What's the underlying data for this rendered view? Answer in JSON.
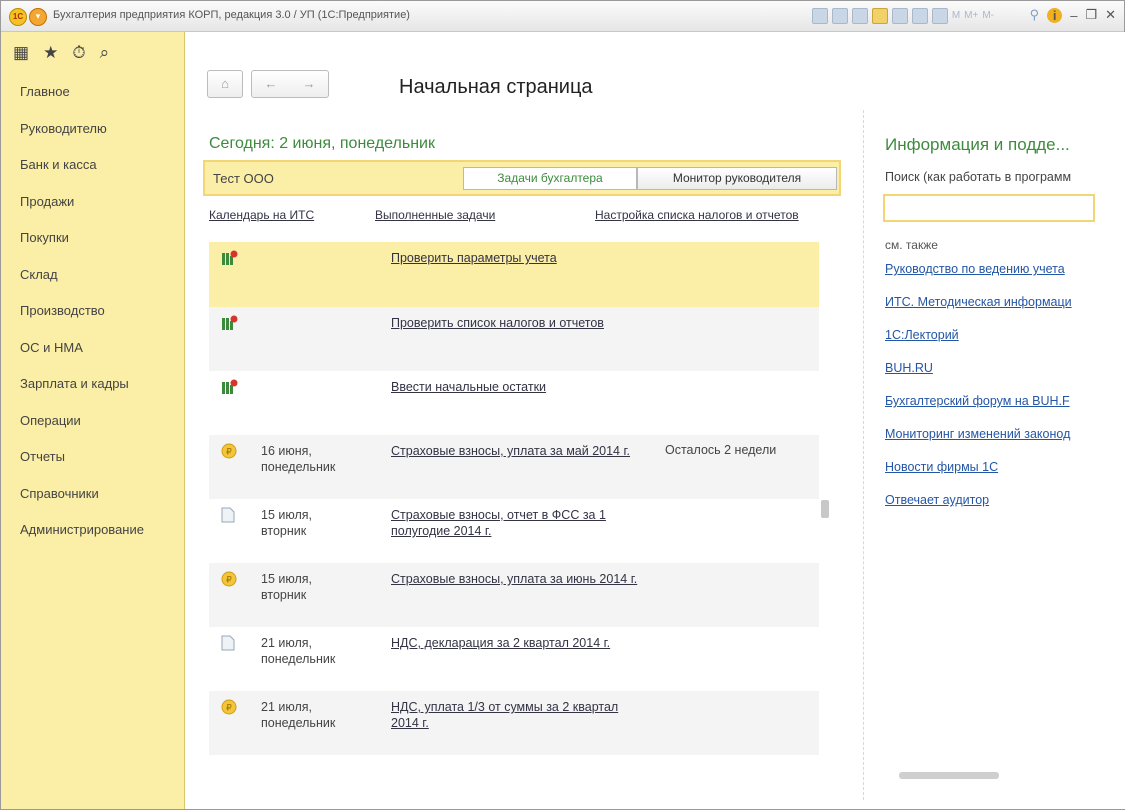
{
  "window": {
    "title": "Бухгалтерия предприятия КОРП, редакция 3.0 / УП  (1С:Предприятие)",
    "mem_buttons": [
      "M",
      "M+",
      "M-"
    ]
  },
  "sidebar": {
    "items": [
      {
        "label": "Главное"
      },
      {
        "label": "Руководителю"
      },
      {
        "label": "Банк и касса"
      },
      {
        "label": "Продажи"
      },
      {
        "label": "Покупки"
      },
      {
        "label": "Склад"
      },
      {
        "label": "Производство"
      },
      {
        "label": "ОС и НМА"
      },
      {
        "label": "Зарплата и кадры"
      },
      {
        "label": "Операции"
      },
      {
        "label": "Отчеты"
      },
      {
        "label": "Справочники"
      },
      {
        "label": "Администрирование"
      }
    ]
  },
  "main": {
    "page_title": "Начальная страница",
    "today": "Сегодня: 2 июня, понедельник",
    "org": "Тест ООО",
    "tabs": {
      "accountant": "Задачи бухгалтера",
      "monitor": "Монитор руководителя"
    },
    "links": {
      "calendar": "Календарь на ИТС",
      "done": "Выполненные задачи",
      "settings": "Настройка списка налогов и отчетов"
    },
    "tasks": [
      {
        "icon": "checklist",
        "date": "",
        "title": "Проверить параметры учета",
        "remaining": ""
      },
      {
        "icon": "checklist",
        "date": "",
        "title": "Проверить список налогов и отчетов",
        "remaining": ""
      },
      {
        "icon": "checklist",
        "date": "",
        "title": "Ввести начальные остатки",
        "remaining": ""
      },
      {
        "icon": "coin",
        "date": "16 июня,\nпонедельник",
        "title": "Страховые взносы, уплата за май 2014 г.",
        "remaining": "Осталось 2 недели"
      },
      {
        "icon": "document",
        "date": "15 июля,\nвторник",
        "title": "Страховые взносы, отчет в ФСС за 1 полугодие 2014 г.",
        "remaining": ""
      },
      {
        "icon": "coin",
        "date": "15 июля,\nвторник",
        "title": "Страховые взносы, уплата за июнь 2014 г.",
        "remaining": ""
      },
      {
        "icon": "document",
        "date": "21 июля,\nпонедельник",
        "title": "НДС, декларация за 2 квартал 2014 г.",
        "remaining": ""
      },
      {
        "icon": "coin",
        "date": "21 июля,\nпонедельник",
        "title": "НДС, уплата 1/3 от суммы за 2 квартал 2014 г.",
        "remaining": ""
      }
    ]
  },
  "info": {
    "title": "Информация и подде...",
    "search_label": "Поиск (как работать в программ",
    "search_value": "",
    "see_also": "см. также",
    "links": [
      "Руководство по ведению учета",
      "ИТС. Методическая информаци",
      "1С:Лекторий",
      "BUH.RU",
      "Бухгалтерский форум на BUH.F",
      "Мониторинг изменений законод",
      "Новости фирмы 1С",
      "Отвечает аудитор"
    ]
  },
  "colors": {
    "sidebar_bg": "#fbeea6",
    "accent_green": "#3e8a3e",
    "link": "#2456a6"
  }
}
